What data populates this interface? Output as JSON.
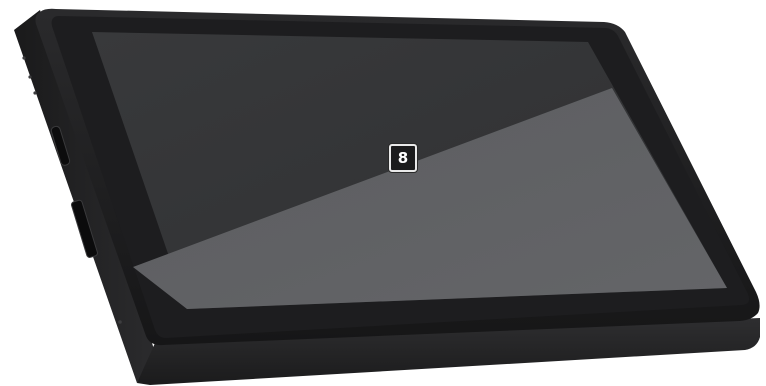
{
  "scene": {
    "subject": "tablet-display-device",
    "background_color": "#ffffff",
    "body_color": "#232325",
    "screen_color": "#3e4043"
  },
  "screen": {
    "callout_number": "8"
  }
}
